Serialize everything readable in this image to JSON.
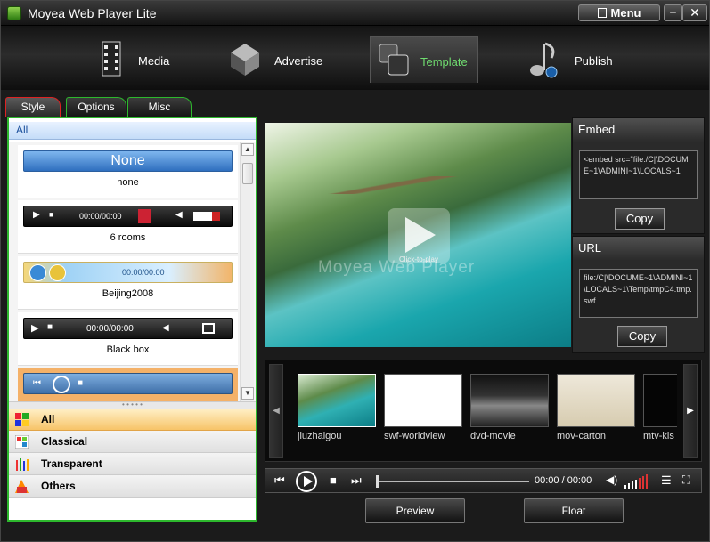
{
  "window": {
    "title": "Moyea Web Player Lite",
    "menu_label": "Menu",
    "minimize_glyph": "–",
    "close_glyph": "✕"
  },
  "nav": {
    "items": [
      {
        "label": "Media",
        "icon": "film-strip-icon"
      },
      {
        "label": "Advertise",
        "icon": "cube-icon"
      },
      {
        "label": "Template",
        "icon": "template-icon",
        "active": true
      },
      {
        "label": "Publish",
        "icon": "music-note-icon"
      }
    ]
  },
  "left_tabs": [
    {
      "label": "Style",
      "active": true
    },
    {
      "label": "Options"
    },
    {
      "label": "Misc"
    }
  ],
  "style_panel": {
    "header": "All",
    "skins": [
      {
        "name": "none",
        "preview_text": "None"
      },
      {
        "name": "6 rooms",
        "preview_time": "00:00/00:00"
      },
      {
        "name": "Beijing2008",
        "preview_time": "00:00/00:00"
      },
      {
        "name": "Black box",
        "preview_time": "00:00/00:00"
      },
      {
        "name": "",
        "selected": true
      }
    ],
    "categories": [
      {
        "label": "All",
        "selected": true
      },
      {
        "label": "Classical"
      },
      {
        "label": "Transparent"
      },
      {
        "label": "Others"
      }
    ]
  },
  "video": {
    "overlay_text": "Click-to-play",
    "watermark": "Moyea Web Player"
  },
  "embed": {
    "title": "Embed",
    "code": "<embed src=\"file:/C|\\DOCUME~1\\ADMINI~1\\LOCALS~1",
    "copy_label": "Copy"
  },
  "url": {
    "title": "URL",
    "code": "file:/C|\\DOCUME~1\\ADMINI~1\\LOCALS~1\\Temp\\tmpC4.tmp.swf",
    "copy_label": "Copy"
  },
  "thumbnails": [
    {
      "label": "jiuzhaigou"
    },
    {
      "label": "swf-worldview"
    },
    {
      "label": "dvd-movie"
    },
    {
      "label": "mov-carton"
    },
    {
      "label": "mtv-kis"
    }
  ],
  "controlbar": {
    "time": "00:00 / 00:00"
  },
  "buttons": {
    "preview": "Preview",
    "float": "Float"
  },
  "colors": {
    "accent_green": "#2db82d",
    "selected_orange": "#f4b168",
    "active_tab_red": "#dd2222"
  }
}
